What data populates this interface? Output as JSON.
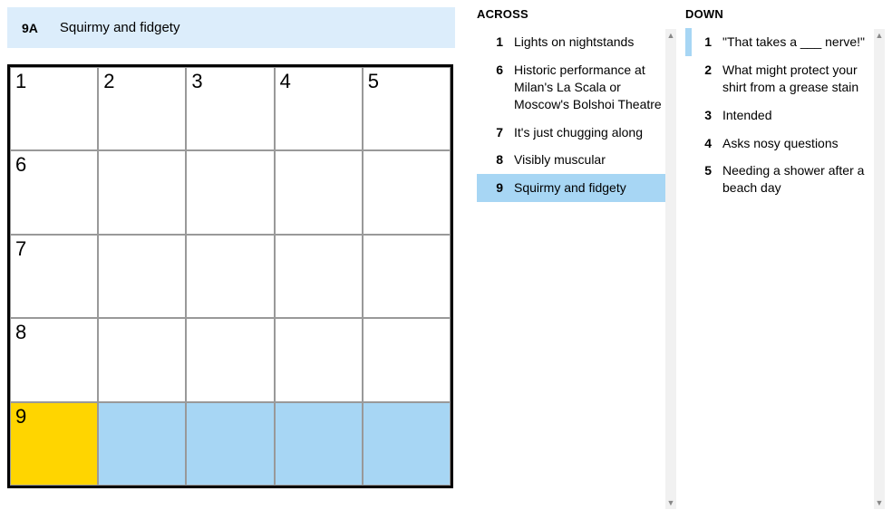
{
  "current_clue": {
    "label": "9A",
    "text": "Squirmy and fidgety"
  },
  "grid": {
    "rows": 5,
    "cols": 5,
    "cells": [
      [
        {
          "num": "1"
        },
        {
          "num": "2"
        },
        {
          "num": "3"
        },
        {
          "num": "4"
        },
        {
          "num": "5"
        }
      ],
      [
        {
          "num": "6"
        },
        {},
        {},
        {},
        {}
      ],
      [
        {
          "num": "7"
        },
        {},
        {},
        {},
        {}
      ],
      [
        {
          "num": "8"
        },
        {},
        {},
        {},
        {}
      ],
      [
        {
          "num": "9",
          "state": "focused"
        },
        {
          "state": "highlighted"
        },
        {
          "state": "highlighted"
        },
        {
          "state": "highlighted"
        },
        {
          "state": "highlighted"
        }
      ]
    ]
  },
  "clues": {
    "across": {
      "header": "ACROSS",
      "items": [
        {
          "num": "1",
          "text": "Lights on nightstands"
        },
        {
          "num": "6",
          "text": "Historic performance at Milan's La Scala or Moscow's Bolshoi Theatre"
        },
        {
          "num": "7",
          "text": "It's just chugging along"
        },
        {
          "num": "8",
          "text": "Visibly muscular"
        },
        {
          "num": "9",
          "text": "Squirmy and fidgety",
          "active": true
        }
      ]
    },
    "down": {
      "header": "DOWN",
      "items": [
        {
          "num": "1",
          "text": "\"That takes a ___ nerve!\"",
          "cross_ref": true
        },
        {
          "num": "2",
          "text": "What might protect your shirt from a grease stain"
        },
        {
          "num": "3",
          "text": "Intended"
        },
        {
          "num": "4",
          "text": "Asks nosy questions"
        },
        {
          "num": "5",
          "text": "Needing a shower after a beach day"
        }
      ]
    }
  }
}
